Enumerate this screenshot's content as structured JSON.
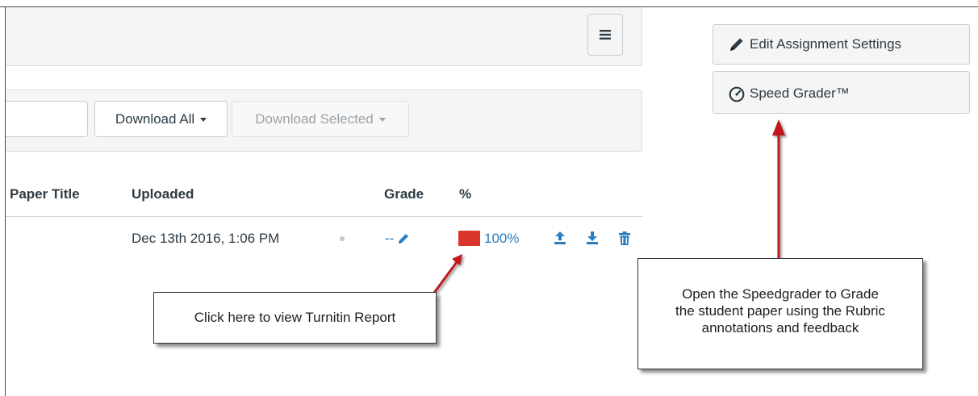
{
  "toolbar": {
    "menu_icon": "hamburger-menu-icon",
    "download_all_label": "Download All",
    "download_selected_label": "Download Selected"
  },
  "table": {
    "columns": [
      "Paper Title",
      "Uploaded",
      "Grade",
      "%"
    ],
    "rows": [
      {
        "paper_title": "",
        "uploaded": "Dec 13th 2016, 1:06 PM",
        "grade": "--",
        "similarity": "100%",
        "similarity_color": "#d9352b",
        "actions": [
          "upload-icon",
          "download-icon",
          "trash-icon"
        ]
      }
    ]
  },
  "sidebar": {
    "edit_settings_label": "Edit Assignment Settings",
    "speed_grader_label": "Speed Grader™"
  },
  "callouts": {
    "turnitin": "Click here to view Turnitin Report",
    "speedgrader_line1": "Open the Speedgrader to Grade",
    "speedgrader_line2": "the student paper using the Rubric",
    "speedgrader_line3": "annotations and feedback"
  },
  "colors": {
    "link": "#2b7ebf",
    "annotation_arrow": "#c0121c",
    "panel_bg": "#f5f5f5"
  }
}
